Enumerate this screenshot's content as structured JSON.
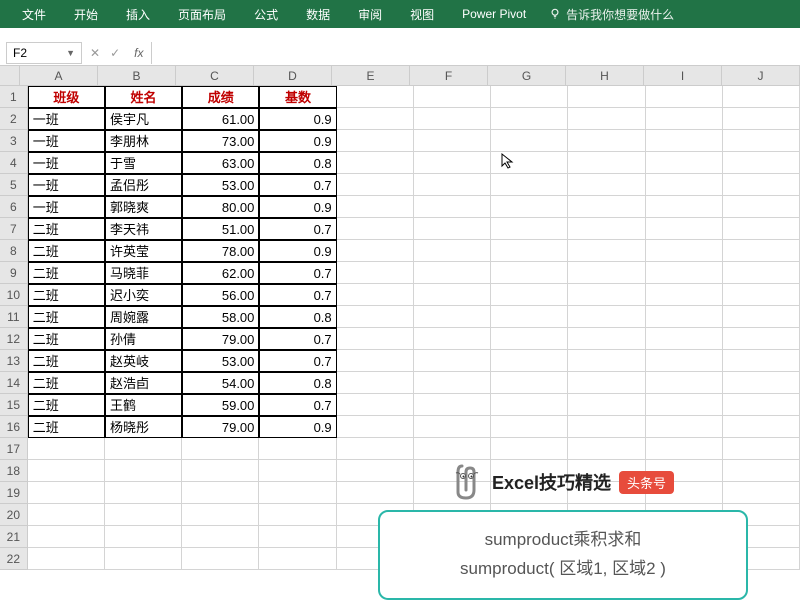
{
  "ribbon": {
    "tabs": [
      "文件",
      "开始",
      "插入",
      "页面布局",
      "公式",
      "数据",
      "审阅",
      "视图",
      "Power Pivot"
    ],
    "tell_me": "告诉我你想要做什么"
  },
  "formula_bar": {
    "name_box": "F2",
    "fx": "fx"
  },
  "columns": [
    "A",
    "B",
    "C",
    "D",
    "E",
    "F",
    "G",
    "H",
    "I",
    "J"
  ],
  "headers": {
    "class": "班级",
    "name": "姓名",
    "score": "成绩",
    "base": "基数"
  },
  "data_rows": [
    {
      "class": "一班",
      "name": "侯宇凡",
      "score": "61.00",
      "base": "0.9"
    },
    {
      "class": "一班",
      "name": "李朋林",
      "score": "73.00",
      "base": "0.9"
    },
    {
      "class": "一班",
      "name": "于雪",
      "score": "63.00",
      "base": "0.8"
    },
    {
      "class": "一班",
      "name": "孟侣彤",
      "score": "53.00",
      "base": "0.7"
    },
    {
      "class": "一班",
      "name": "郭晓爽",
      "score": "80.00",
      "base": "0.9"
    },
    {
      "class": "二班",
      "name": "李天祎",
      "score": "51.00",
      "base": "0.7"
    },
    {
      "class": "二班",
      "name": "许英莹",
      "score": "78.00",
      "base": "0.9"
    },
    {
      "class": "二班",
      "name": "马晓菲",
      "score": "62.00",
      "base": "0.7"
    },
    {
      "class": "二班",
      "name": "迟小奕",
      "score": "56.00",
      "base": "0.7"
    },
    {
      "class": "二班",
      "name": "周婉露",
      "score": "58.00",
      "base": "0.8"
    },
    {
      "class": "二班",
      "name": "孙倩",
      "score": "79.00",
      "base": "0.7"
    },
    {
      "class": "二班",
      "name": "赵英岐",
      "score": "53.00",
      "base": "0.7"
    },
    {
      "class": "二班",
      "name": "赵浩卣",
      "score": "54.00",
      "base": "0.8"
    },
    {
      "class": "二班",
      "name": "王鹤",
      "score": "59.00",
      "base": "0.7"
    },
    {
      "class": "二班",
      "name": "杨晓彤",
      "score": "79.00",
      "base": "0.9"
    }
  ],
  "empty_rows": [
    "17",
    "18",
    "19",
    "20",
    "21",
    "22"
  ],
  "clippy": {
    "title": "Excel技巧精选",
    "badge": "头条号",
    "line1": "sumproduct乘积求和",
    "line2": "sumproduct( 区域1, 区域2 )"
  }
}
